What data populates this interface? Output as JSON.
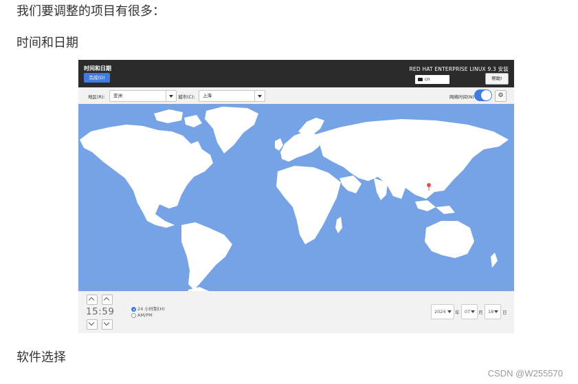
{
  "article": {
    "intro": "我们要调整的项目有很多：",
    "section_time": "时间和日期",
    "section_software": "软件选择",
    "watermark": "CSDN @W255570"
  },
  "installer": {
    "title": "时间和日期",
    "done_label": "完成(D)",
    "product": "RED HAT ENTERPRISE LINUX 9.3 安装",
    "keyboard": "cn",
    "help_label": "帮助!",
    "region_label": "地区(R):",
    "region_value": "亚洲",
    "city_label": "城市(C):",
    "city_value": "上海",
    "ntp_label": "网络时间(N)",
    "ntp_enabled": true,
    "time": "15:59",
    "format_24h": "24 小时制(H)",
    "format_ampm": "AM/PM",
    "year": "2024",
    "year_unit": "年",
    "month": "07",
    "month_unit": "月",
    "day": "18",
    "day_unit": "日"
  },
  "colors": {
    "topbar": "#2b2b2b",
    "accent": "#3f7be0",
    "ocean": "#75a3e6",
    "land": "#ffffff",
    "marker": "#e05050"
  },
  "icons": [
    "keyboard-icon",
    "gear-icon",
    "chevron-up-icon",
    "chevron-down-icon",
    "dropdown-arrow-icon",
    "location-pin-icon"
  ]
}
